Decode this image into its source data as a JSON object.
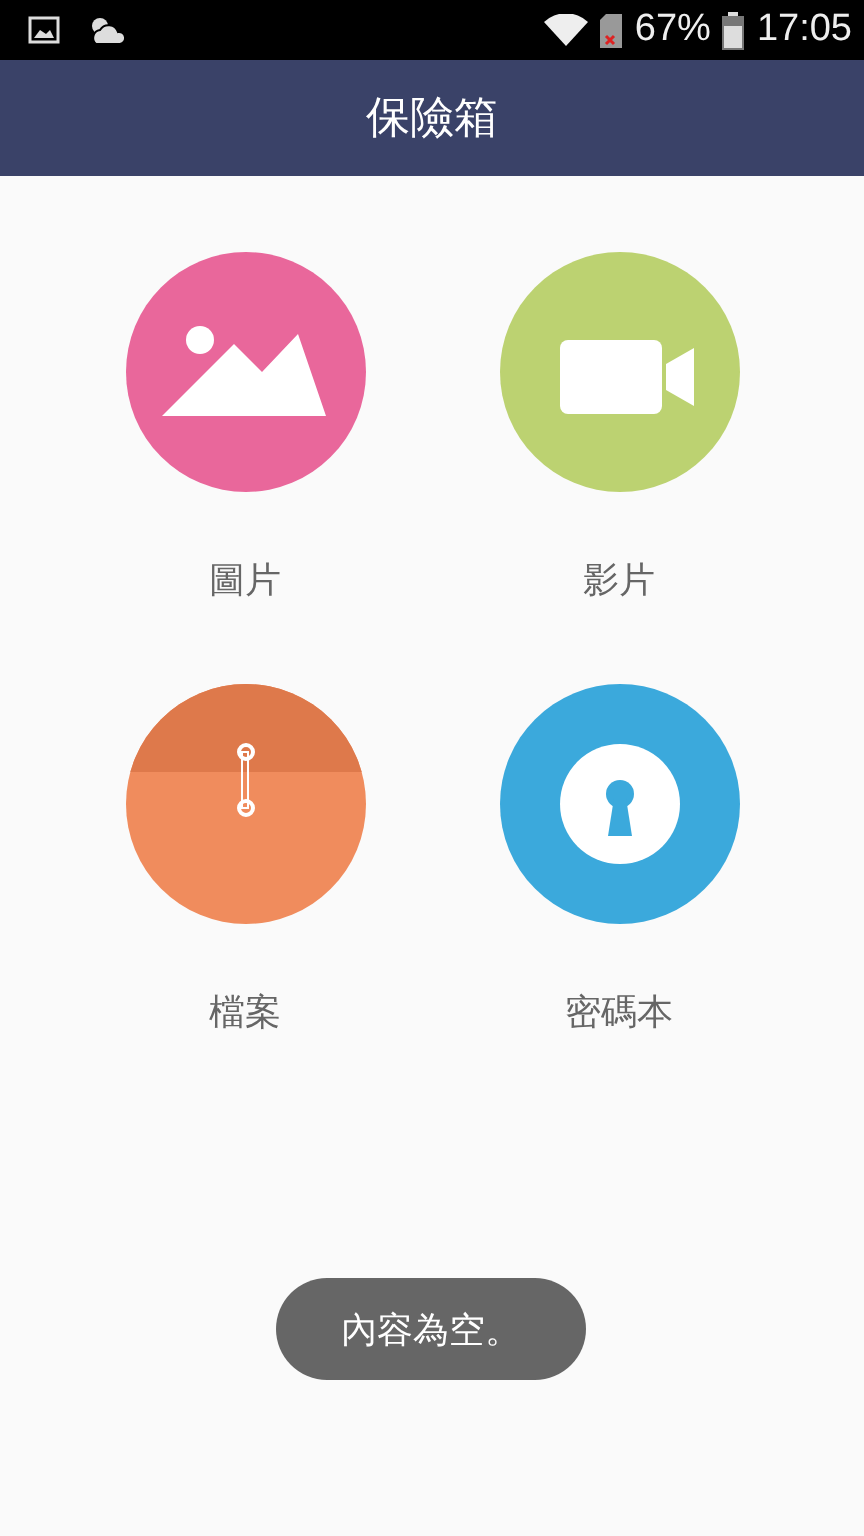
{
  "status_bar": {
    "battery": "67%",
    "time": "17:05"
  },
  "header": {
    "title": "保險箱"
  },
  "tiles": [
    {
      "kind": "picture",
      "label": "圖片"
    },
    {
      "kind": "video",
      "label": "影片"
    },
    {
      "kind": "folder",
      "label": "檔案"
    },
    {
      "kind": "lock",
      "label": "密碼本"
    }
  ],
  "toast": {
    "text": "內容為空。"
  }
}
